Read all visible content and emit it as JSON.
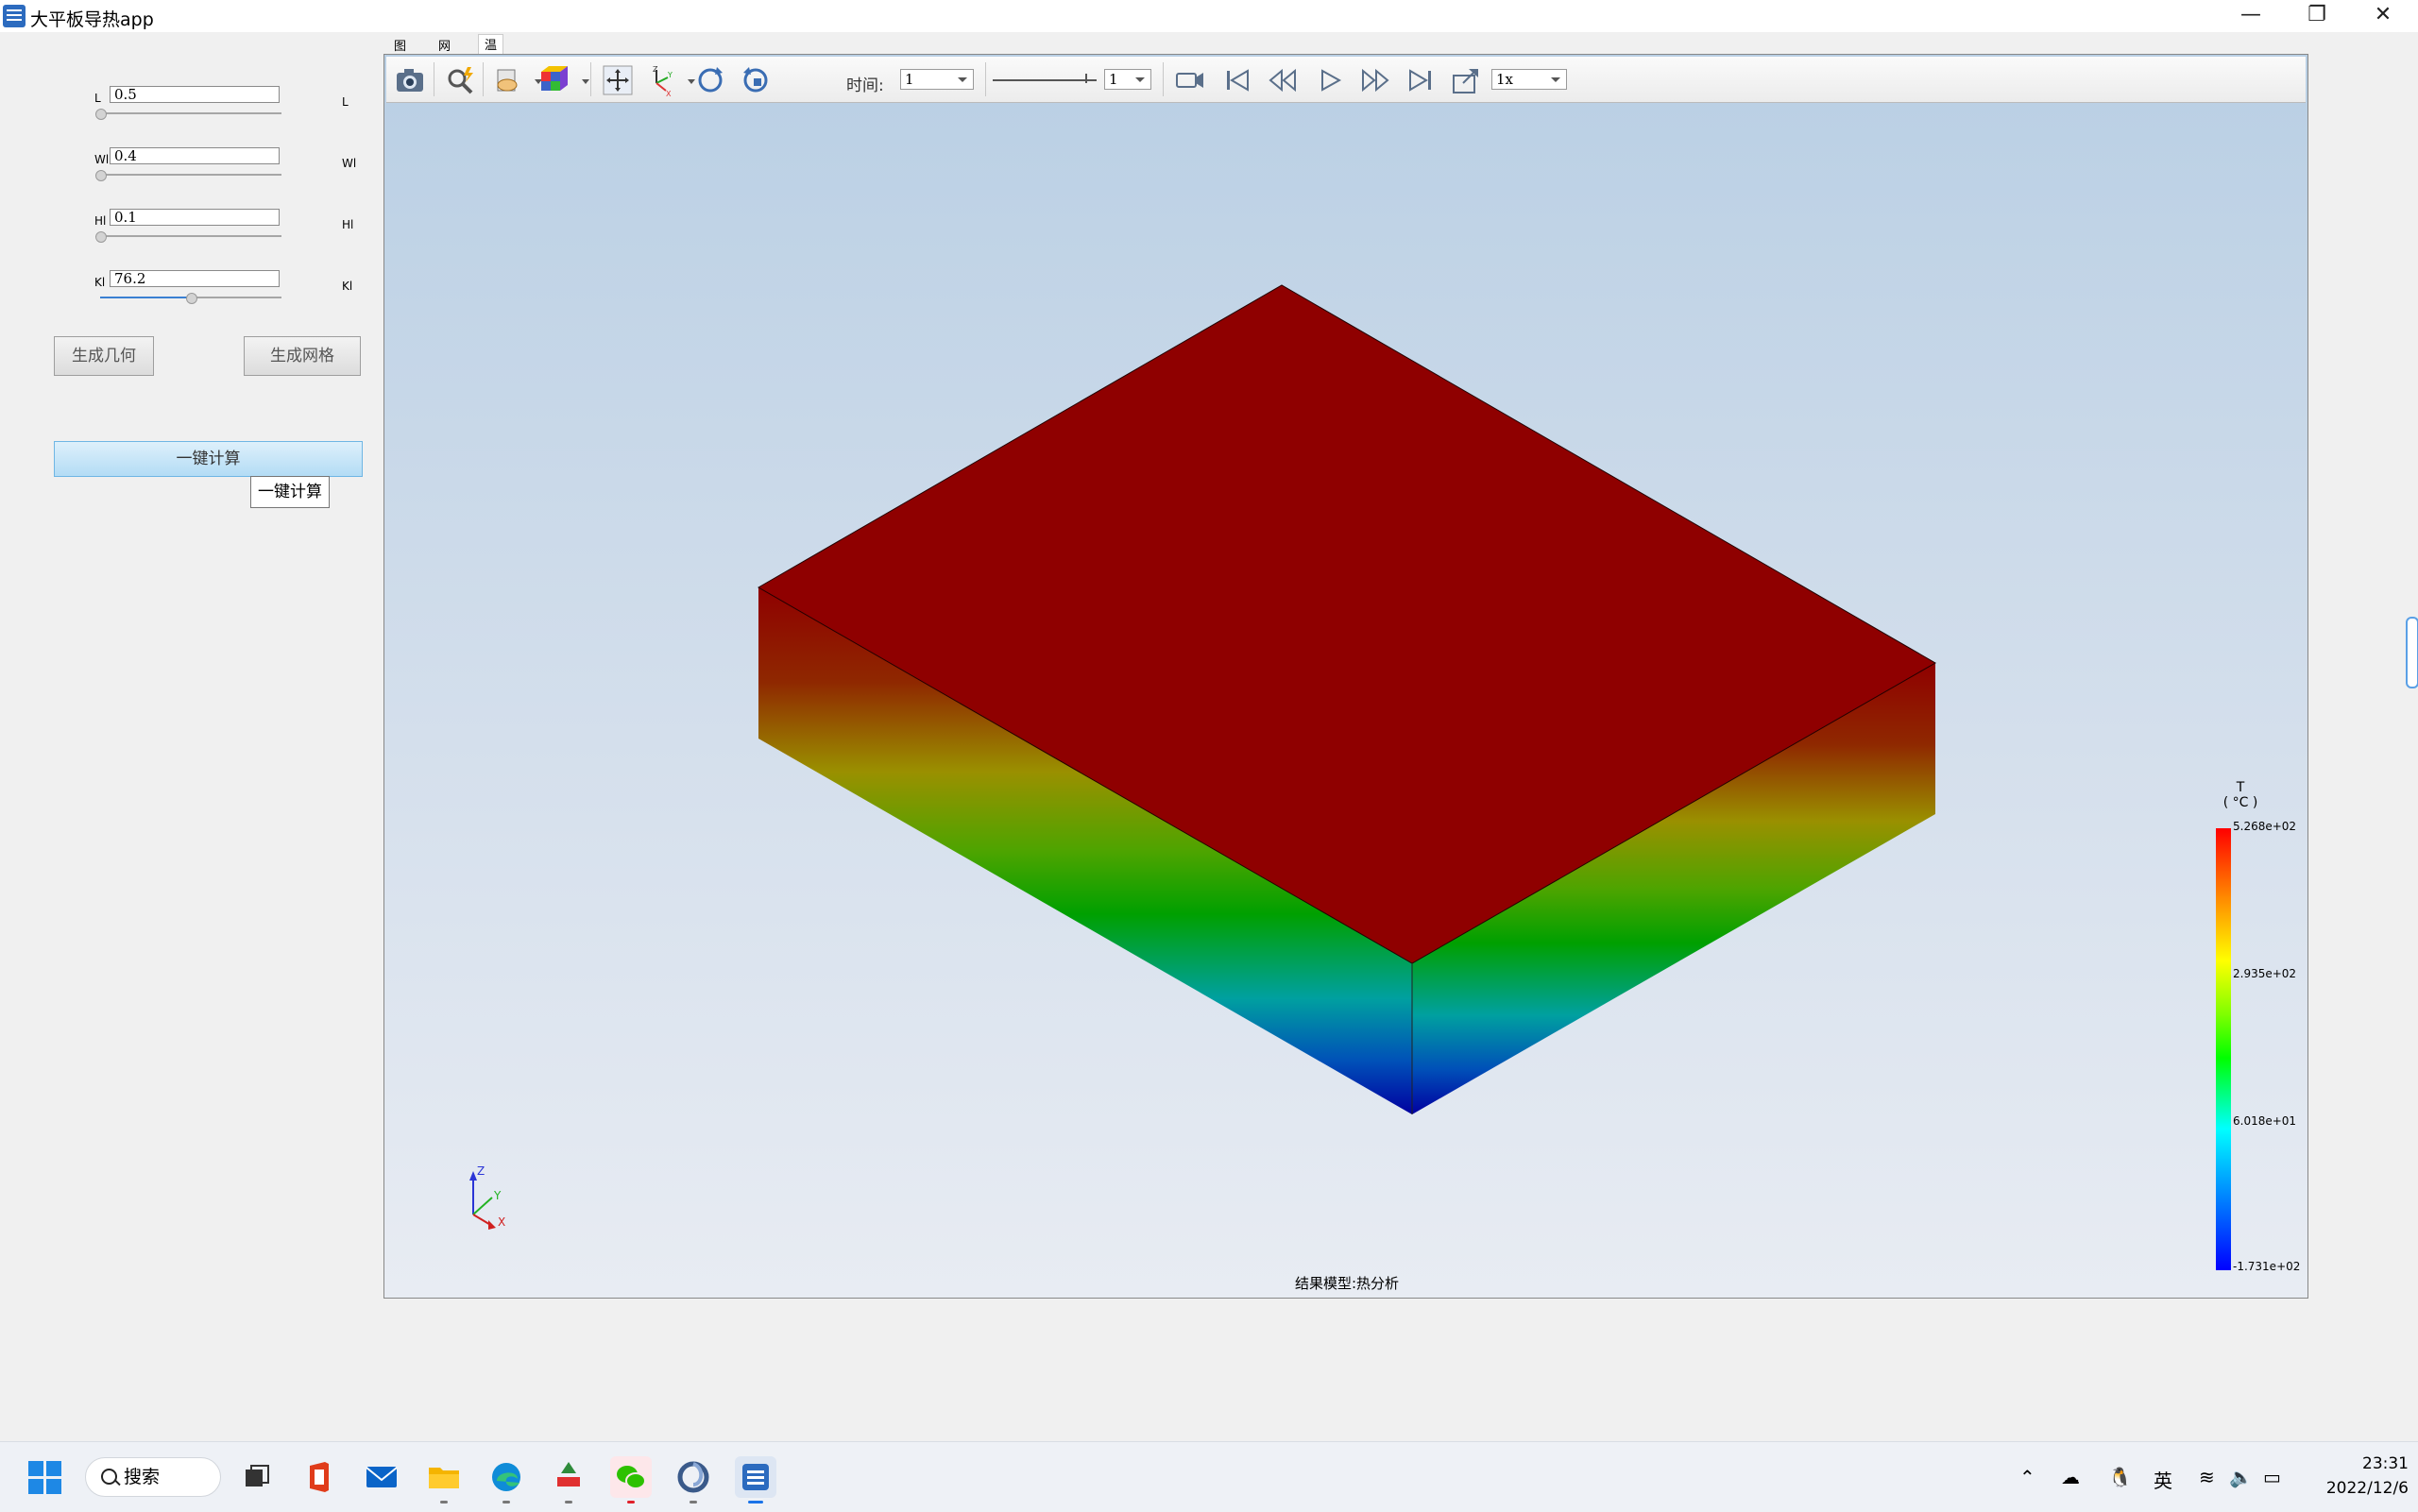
{
  "window": {
    "title": "大平板导热app",
    "minimize": "—",
    "restore": "❐",
    "close": "✕"
  },
  "params": [
    {
      "label": "L",
      "value": "0.5",
      "right_label": "L",
      "slider_fraction": 0.0
    },
    {
      "label": "Wl",
      "value": "0.4",
      "right_label": "Wl",
      "slider_fraction": 0.0
    },
    {
      "label": "Hl",
      "value": "0.1",
      "right_label": "Hl",
      "slider_fraction": 0.0
    },
    {
      "label": "Kl",
      "value": "76.2",
      "right_label": "Kl",
      "slider_fraction": 0.5
    }
  ],
  "buttons": {
    "gen_geometry": "生成几何",
    "gen_mesh": "生成网格",
    "compute": "一键计算",
    "tooltip": "一键计算"
  },
  "tabs": [
    "图形",
    "网格",
    "温度分布"
  ],
  "toolbar": {
    "time_label": "时间:",
    "time_value": "1",
    "frame_value": "1",
    "speed": "1x"
  },
  "viewer": {
    "status": "结果模型:热分析",
    "legend": {
      "title": "T",
      "unit": "( °C )",
      "ticks": [
        "5.268e+02",
        "2.935e+02",
        "6.018e+01",
        "-1.731e+02"
      ]
    },
    "triad": {
      "z": "Z",
      "y": "Y",
      "x": "X"
    }
  },
  "taskbar": {
    "search": "搜索",
    "ime": "英",
    "time": "23:31",
    "date": "2022/12/6"
  },
  "colors": {
    "top_face": "#8f0000",
    "accent": "#3a80d2"
  }
}
